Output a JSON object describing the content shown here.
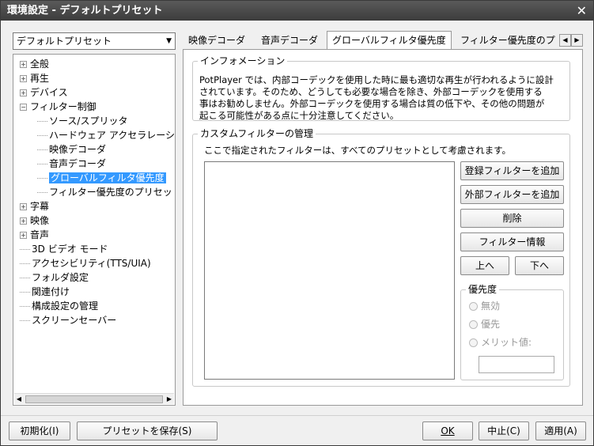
{
  "window": {
    "title": "環境設定 - デフォルトプリセット",
    "close_glyph": "✕"
  },
  "preset_select": {
    "value": "デフォルトプリセット"
  },
  "tree": {
    "items": [
      {
        "label": "全般",
        "expander": "+",
        "indent": 0
      },
      {
        "label": "再生",
        "expander": "+",
        "indent": 0
      },
      {
        "label": "デバイス",
        "expander": "+",
        "indent": 0
      },
      {
        "label": "フィルター制御",
        "expander": "−",
        "indent": 0
      },
      {
        "label": "ソース/スプリッタ",
        "indent": 1
      },
      {
        "label": "ハードウェア アクセラレーシ",
        "indent": 1
      },
      {
        "label": "映像デコーダ",
        "indent": 1
      },
      {
        "label": "音声デコーダ",
        "indent": 1
      },
      {
        "label": "グローバルフィルタ優先度",
        "indent": 1,
        "selected": true
      },
      {
        "label": "フィルター優先度のプリセッ",
        "indent": 1
      },
      {
        "label": "字幕",
        "expander": "+",
        "indent": 0
      },
      {
        "label": "映像",
        "expander": "+",
        "indent": 0
      },
      {
        "label": "音声",
        "expander": "+",
        "indent": 0
      },
      {
        "label": "3D ビデオ モード",
        "indent": 0
      },
      {
        "label": "アクセシビリティ(TTS/UIA)",
        "indent": 0
      },
      {
        "label": "フォルダ設定",
        "indent": 0
      },
      {
        "label": "関連付け",
        "indent": 0
      },
      {
        "label": "構成設定の管理",
        "indent": 0
      },
      {
        "label": "スクリーンセーバー",
        "indent": 0
      }
    ]
  },
  "tabs": [
    {
      "label": "映像デコーダ"
    },
    {
      "label": "音声デコーダ"
    },
    {
      "label": "グローバルフィルタ優先度",
      "active": true
    },
    {
      "label": "フィルター優先度のプ"
    }
  ],
  "info": {
    "title": "インフォメーション",
    "lines": [
      "PotPlayer では、内部コーデックを使用した時に最も適切な再生が行われるように設計",
      "されています。そのため、どうしても必要な場合を除き、外部コーデックを使用する",
      "事はお勧めしません。外部コーデックを使用する場合は質の低下や、その他の問題が",
      "起こる可能性がある点に十分注意してください。"
    ]
  },
  "custom": {
    "title": "カスタムフィルターの管理",
    "description": "ここで指定されたフィルターは、すべてのプリセットとして考慮されます。",
    "buttons": {
      "add_registered": "登録フィルターを追加",
      "add_external": "外部フィルターを追加",
      "delete": "削除",
      "filter_info": "フィルター情報",
      "up": "上へ",
      "down": "下へ"
    },
    "priority": {
      "title": "優先度",
      "options": [
        "無効",
        "優先",
        "メリット値:"
      ]
    }
  },
  "footer": {
    "reset": "初期化(I)",
    "save_preset": "プリセットを保存(S)",
    "ok": "OK",
    "cancel": "中止(C)",
    "apply": "適用(A)"
  }
}
